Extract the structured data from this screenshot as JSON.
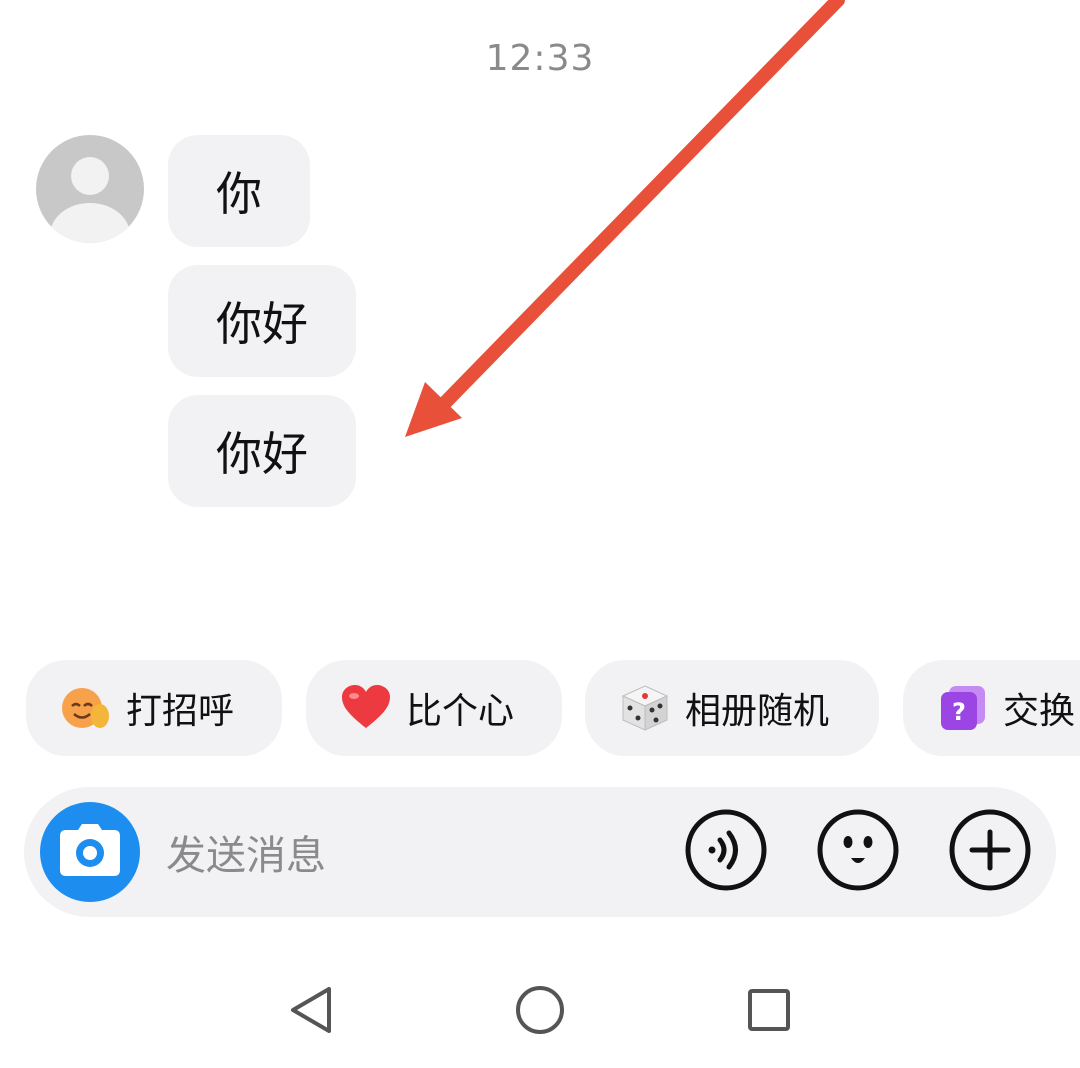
{
  "status": {
    "time": "12:33"
  },
  "conversation": {
    "messages": [
      {
        "text": "你"
      },
      {
        "text": "你好"
      },
      {
        "text": "你好"
      }
    ]
  },
  "annotation": {
    "arrow_color": "#e8503a"
  },
  "quick_replies": [
    {
      "label": "打招呼",
      "icon": "wave-hand-emoji-icon"
    },
    {
      "label": "比个心",
      "icon": "heart-icon"
    },
    {
      "label": "相册随机",
      "icon": "dice-icon"
    },
    {
      "label": "交换",
      "icon": "question-card-icon"
    }
  ],
  "composer": {
    "placeholder": "发送消息",
    "accent_color": "#1d8ef0",
    "icons": [
      "camera-icon",
      "voice-icon",
      "emoji-icon",
      "plus-icon"
    ]
  },
  "navigation": {
    "icons": [
      "back-icon",
      "home-icon",
      "recent-apps-icon"
    ]
  }
}
